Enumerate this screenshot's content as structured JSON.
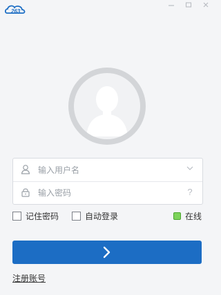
{
  "app": {
    "logo_text": "263",
    "accent_color": "#1c6dc4"
  },
  "window": {
    "minimize_icon": "minimize-icon",
    "maximize_icon": "maximize-icon",
    "close_icon": "close-icon"
  },
  "avatar": {
    "icon": "user-avatar-icon"
  },
  "login_form": {
    "username_placeholder": "输入用户名",
    "password_placeholder": "输入密码",
    "username_icon": "user-icon",
    "password_icon": "lock-icon",
    "username_dropdown_icon": "chevron-down-icon",
    "password_help_icon": "question-icon"
  },
  "options": {
    "remember_password": "记住密码",
    "auto_login": "自动登录",
    "status": "在线",
    "status_color": "#7dd35a"
  },
  "submit": {
    "icon": "chevron-right-icon"
  },
  "footer": {
    "register_link": "注册账号"
  }
}
